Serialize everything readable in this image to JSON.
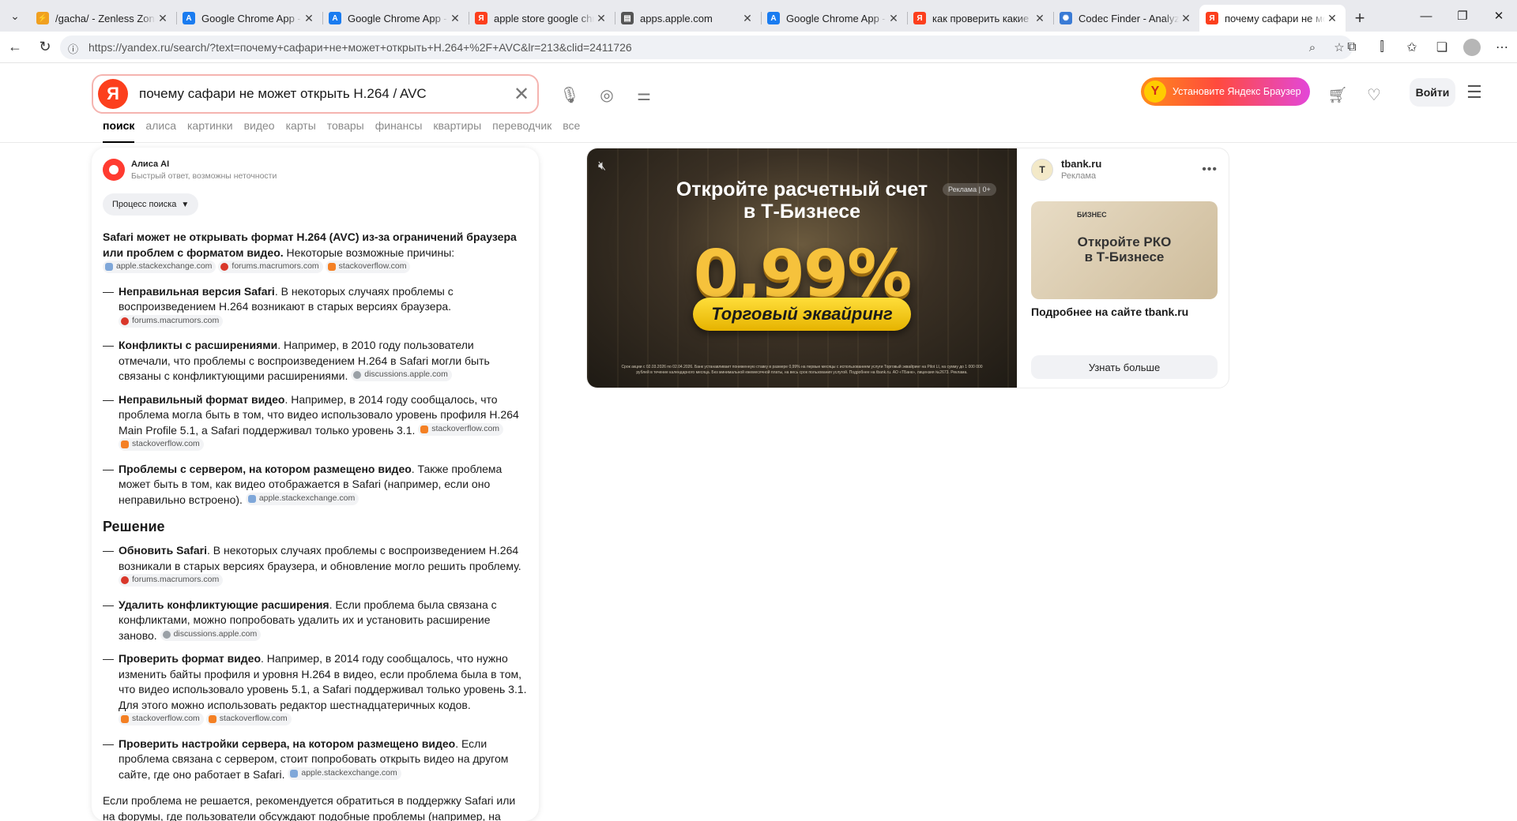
{
  "tabs": [
    {
      "title": "/gacha/ - Zenless Zone Zero",
      "fav_color": "#f0a020",
      "fav_glyph": "⚡"
    },
    {
      "title": "Google Chrome App - App Store",
      "fav_color": "#1a7cf0",
      "fav_glyph": "A"
    },
    {
      "title": "Google Chrome App - App Store",
      "fav_color": "#1a7cf0",
      "fav_glyph": "A"
    },
    {
      "title": "apple store google chrome",
      "fav_color": "#fc3f1d",
      "fav_glyph": "Я"
    },
    {
      "title": "apps.apple.com",
      "fav_color": "#555555",
      "fav_glyph": "▤"
    },
    {
      "title": "Google Chrome App - App Store",
      "fav_color": "#1a7cf0",
      "fav_glyph": "A"
    },
    {
      "title": "как проверить какие кодеки",
      "fav_color": "#fc3f1d",
      "fav_glyph": "Я"
    },
    {
      "title": "Codec Finder - Analyze",
      "fav_color": "#3a7bd5",
      "fav_glyph": "✺"
    },
    {
      "title": "почему сафари не может",
      "fav_color": "#fc3f1d",
      "fav_glyph": "Я",
      "active": true
    }
  ],
  "browser": {
    "url": "https://yandex.ru/search/?text=почему+сафари+не+может+открыть+H.264+%2F+AVC&lr=213&clid=2411726"
  },
  "header": {
    "logo": "Я",
    "query": "почему сафари не может открыть H.264 / AVC",
    "install_label": "Установите Яндекс Браузер",
    "login_label": "Войти"
  },
  "nav": [
    {
      "label": "поиск",
      "active": true
    },
    {
      "label": "алиса"
    },
    {
      "label": "картинки"
    },
    {
      "label": "видео"
    },
    {
      "label": "карты"
    },
    {
      "label": "товары"
    },
    {
      "label": "финансы"
    },
    {
      "label": "квартиры"
    },
    {
      "label": "переводчик"
    },
    {
      "label": "все"
    }
  ],
  "alice": {
    "name": "Алиса AI",
    "note": "Быстрый ответ, возможны неточности",
    "process_label": "Процесс поиска",
    "intro_bold": "Safari может не открывать формат H.264 (AVC) из-за ограничений браузера или проблем с форматом видео.",
    "intro_rest": " Некоторые возможные причины:",
    "intro_sources": [
      "apple.stackexchange.com",
      "forums.macrumors.com",
      "stackoverflow.com"
    ],
    "causes": [
      {
        "bold": "Неправильная версия Safari",
        "text": ". В некоторых случаях проблемы с воспроизведением H.264 возникают в старых версиях браузера.",
        "sources": [
          "forums.macrumors.com"
        ]
      },
      {
        "bold": "Конфликты с расширениями",
        "text": ". Например, в 2010 году пользователи отмечали, что проблемы с воспроизведением H.264 в Safari могли быть связаны с конфликтующими расширениями.",
        "sources": [
          "discussions.apple.com"
        ]
      },
      {
        "bold": "Неправильный формат видео",
        "text": ". Например, в 2014 году сообщалось, что проблема могла быть в том, что видео использовало уровень профиля H.264 Main Profile 5.1, а Safari поддерживал только уровень 3.1.",
        "sources": [
          "stackoverflow.com",
          "stackoverflow.com"
        ]
      },
      {
        "bold": "Проблемы с сервером, на котором размещено видео",
        "text": ". Также проблема может быть в том, как видео отображается в Safari (например, если оно неправильно встроено).",
        "sources": [
          "apple.stackexchange.com"
        ]
      }
    ],
    "solution_title": "Решение",
    "solutions": [
      {
        "bold": "Обновить Safari",
        "text": ". В некоторых случаях проблемы с воспроизведением H.264 возникали в старых версиях браузера, и обновление могло решить проблему.",
        "sources": [
          "forums.macrumors.com"
        ]
      },
      {
        "bold": "Удалить конфликтующие расширения",
        "text": ". Если проблема была связана с конфликтами, можно попробовать удалить их и установить расширение заново.",
        "sources": [
          "discussions.apple.com"
        ]
      },
      {
        "bold": "Проверить формат видео",
        "text": ". Например, в 2014 году сообщалось, что нужно изменить байты профиля и уровня H.264 в видео, если проблема была в том, что видео использовало уровень 5.1, а Safari поддерживал только уровень 3.1. Для этого можно использовать редактор шестнадцатеричных кодов.",
        "sources": [
          "stackoverflow.com",
          "stackoverflow.com"
        ]
      },
      {
        "bold": "Проверить настройки сервера, на котором размещено видео",
        "text": ". Если проблема связана с сервером, стоит попробовать открыть видео на другом сайте, где оно работает в Safari.",
        "sources": [
          "apple.stackexchange.com"
        ]
      }
    ],
    "closing": "Если проблема не решается, рекомендуется обратиться в поддержку Safari или на форумы, где пользователи обсуждают подобные проблемы (например, на"
  },
  "ad": {
    "headline_1": "Откройте расчетный счет",
    "headline_2": "в Т-Бизнесе",
    "badge": "Реклама | 0+",
    "big_value": "0,99%",
    "pill": "Торговый эквайринг",
    "fine_print": "Срок акции с 02.03.2026 по 02.04.2026. Банк устанавливает пониженную ставку в размере 0,99% на первые месяцы с использованием услуги Торговый эквайринг на Pilot LI, на сумму до 1 000 000 рублей в течение календарного месяца. Без минимальной ежемесячной платы, на весь срок пользования услугой. Подробнее на tbank.ru. АО «ТБанк», лицензия №2673. Реклама.",
    "advertiser": "tbank.ru",
    "ad_label": "Реклама",
    "thumb_brand": "БИЗНЕС",
    "thumb_line_1": "Откройте РКО",
    "thumb_line_2": "в Т-Бизнесе",
    "more_label": "Подробнее на сайте tbank.ru",
    "cta_label": "Узнать больше"
  },
  "colors": {
    "yandex_red": "#fc3f1d",
    "ad_gold": "#f6c23c"
  }
}
